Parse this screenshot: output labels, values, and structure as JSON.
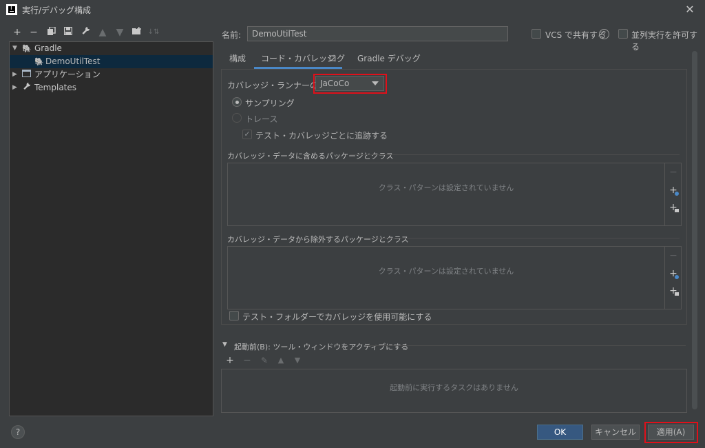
{
  "window": {
    "title": "実行/デバッグ構成",
    "close_glyph": "✕"
  },
  "toolbar": {
    "icons": [
      "plus-icon",
      "minus-icon",
      "copy-icon",
      "save-icon",
      "wrench-icon",
      "up-arrow-icon",
      "down-arrow-icon",
      "folder-add-icon",
      "sort-icon"
    ]
  },
  "tree": {
    "items": [
      {
        "label": "Gradle",
        "icon": "gradle-icon",
        "expanded": true
      },
      {
        "label": "DemoUtilTest",
        "icon": "gradle-icon",
        "selected": true
      },
      {
        "label": "アプリケーション",
        "icon": "application-icon",
        "expanded": false
      },
      {
        "label": "Templates",
        "icon": "wrench-icon",
        "expanded": false
      }
    ]
  },
  "form": {
    "name_label": "名前:",
    "name_value": "DemoUtilTest",
    "vcs_share_label": "VCS で共有する",
    "parallel_label": "並列実行を許可する"
  },
  "tabs": [
    {
      "label": "構成",
      "active": false
    },
    {
      "label": "コード・カバレッジ",
      "active": true
    },
    {
      "label": "ログ",
      "active": false
    },
    {
      "label": "Gradle デバッグ",
      "active": false
    }
  ],
  "coverage": {
    "runner_label": "カバレッジ・ランナーの選択:",
    "runner_value": "JaCoCo",
    "sampling_label": "サンプリング",
    "tracing_label": "トレース",
    "track_per_test_label": "テスト・カバレッジごとに追跡する",
    "include_title": "カバレッジ・データに含めるパッケージとクラス",
    "include_empty": "クラス・パターンは設定されていません",
    "exclude_title": "カバレッジ・データから除外するパッケージとクラス",
    "exclude_empty": "クラス・パターンは設定されていません",
    "test_folders_label": "テスト・フォルダーでカバレッジを使用可能にする"
  },
  "before_launch": {
    "title": "起動前(B): ツール・ウィンドウをアクティブにする",
    "empty": "起動前に実行するタスクはありません"
  },
  "buttons": {
    "ok": "OK",
    "cancel": "キャンセル",
    "apply": "適用(A)",
    "help": "?"
  },
  "colors": {
    "accent": "#4a88c7",
    "highlight_box": "#e0101a",
    "background": "#3c3f41",
    "selection": "#0d293e"
  }
}
